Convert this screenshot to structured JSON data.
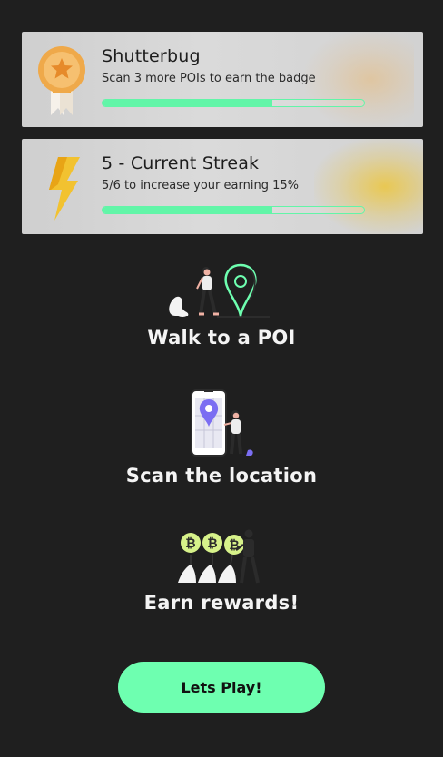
{
  "cards": [
    {
      "title": "Shutterbug",
      "subtitle": "Scan 3 more POIs to earn the badge",
      "icon": "medal-icon",
      "progress": 0.65
    },
    {
      "title": "5 - Current Streak",
      "subtitle": "5/6 to increase your earning 15%",
      "icon": "lightning-bolt-icon",
      "progress": 0.65
    }
  ],
  "steps": [
    {
      "label": "Walk to a POI",
      "icon": "walking-person-map-pin-icon"
    },
    {
      "label": "Scan the location",
      "icon": "phone-scan-location-icon"
    },
    {
      "label": "Earn rewards!",
      "icon": "bitcoin-rewards-icon"
    }
  ],
  "cta": {
    "label": "Lets Play!"
  },
  "colors": {
    "background": "#1f1f1f",
    "accent": "#6effb0",
    "card": "#d6d6d6",
    "streak": "#f0c428",
    "badge": "#e8ba78"
  }
}
